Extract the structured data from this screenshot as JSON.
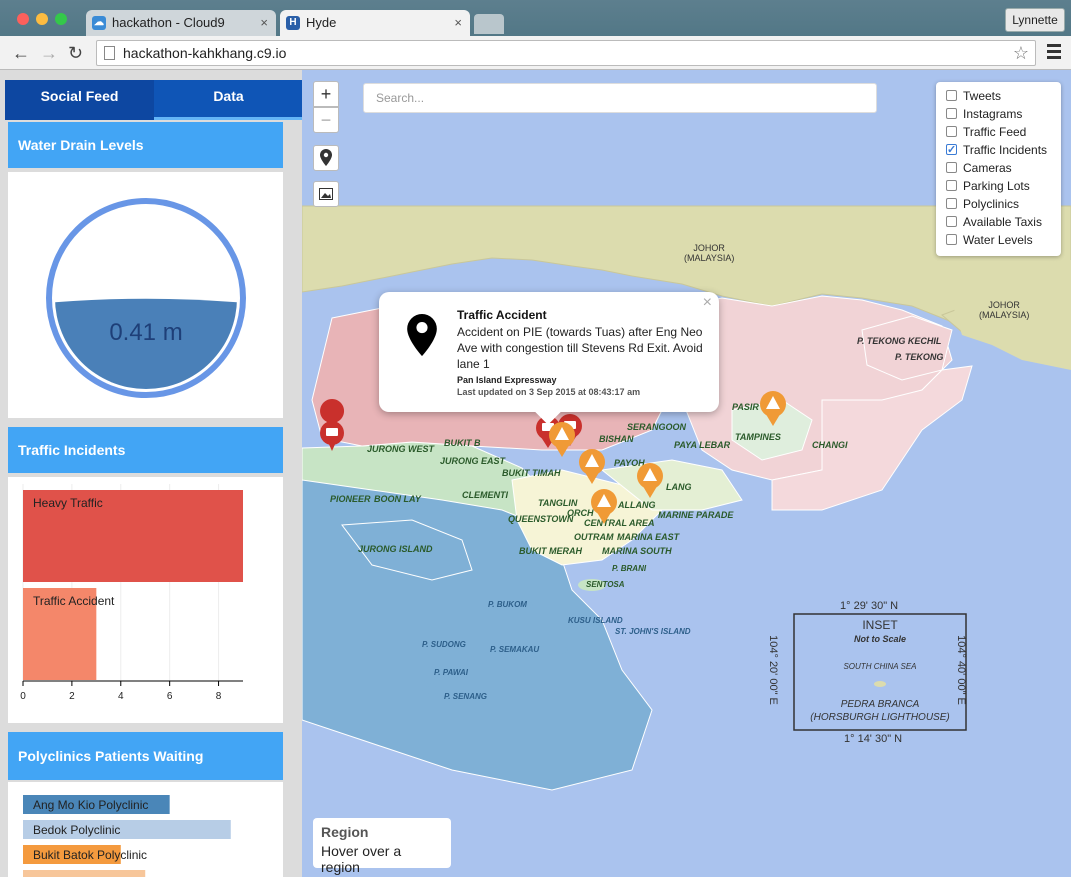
{
  "browser": {
    "tabs": [
      {
        "title": "hackathon - Cloud9",
        "close": "×"
      },
      {
        "title": "Hyde",
        "close": "×"
      }
    ],
    "url": "hackathon-kahkhang.c9.io",
    "user": "Lynnette",
    "back": "←",
    "forward": "→",
    "reload": "↻",
    "star": "☆"
  },
  "sidebar": {
    "tabs": [
      "Social Feed",
      "Data"
    ],
    "water": {
      "title": "Water Drain Levels",
      "value": "0.41 m",
      "level_fraction": 0.41
    },
    "traffic": {
      "title": "Traffic Incidents",
      "chart_data": {
        "type": "bar",
        "orientation": "horizontal",
        "categories": [
          "Heavy Traffic",
          "Traffic Accident"
        ],
        "values": [
          9,
          3
        ],
        "xlim": [
          0,
          9
        ],
        "xticks": [
          "0",
          "2",
          "4",
          "6",
          "8"
        ],
        "colors": [
          "#e0524a",
          "#f4876a"
        ]
      }
    },
    "polyclinics": {
      "title": "Polyclinics Patients Waiting",
      "chart_data": {
        "type": "bar",
        "orientation": "horizontal",
        "categories": [
          "Ang Mo Kio Polyclinic",
          "Bedok Polyclinic",
          "Bukit Batok Polyclinic",
          ""
        ],
        "values": [
          6,
          8.5,
          4,
          5
        ],
        "xlim": [
          0,
          9
        ],
        "colors": [
          "#4a86b8",
          "#b7cde6",
          "#f49a3e",
          "#f7c69a"
        ]
      }
    }
  },
  "map": {
    "zoom_in": "+",
    "zoom_out": "−",
    "search_placeholder": "Search...",
    "layers": [
      {
        "label": "Tweets",
        "checked": false
      },
      {
        "label": "Instagrams",
        "checked": false
      },
      {
        "label": "Traffic Feed",
        "checked": false
      },
      {
        "label": "Traffic Incidents",
        "checked": true
      },
      {
        "label": "Cameras",
        "checked": false
      },
      {
        "label": "Parking Lots",
        "checked": false
      },
      {
        "label": "Polyclinics",
        "checked": false
      },
      {
        "label": "Available Taxis",
        "checked": false
      },
      {
        "label": "Water Levels",
        "checked": false
      }
    ],
    "popup": {
      "title": "Traffic Accident",
      "body": "Accident on PIE (towards Tuas) after Eng Neo Ave with congestion till Stevens Rd Exit. Avoid lane 1",
      "road": "Pan Island Expressway",
      "updated": "Last updated on 3 Sep 2015 at 08:43:17 am",
      "close": "×"
    },
    "region": {
      "title": "Region",
      "hint": "Hover over a region"
    },
    "labels": {
      "johor1": "JOHOR\n(MALAYSIA)",
      "johor2": "JOHOR\n(MALAYSIA)",
      "tekong_kechil": "P. TEKONG KECHIL",
      "tekong": "P. TEKONG",
      "pasir": "PASIR R",
      "tampines": "TAMPINES",
      "changi": "CHANGI",
      "serangoon": "SERANGOON",
      "bishan": "BISHAN",
      "paya_lebar": "PAYA LEBAR",
      "payoh": "PAYOH",
      "bukit_timah": "BUKIT TIMAH",
      "jurong_west": "JURONG WEST",
      "jurong_east": "JURONG EAST",
      "bukit_b": "BUKIT B",
      "clementi": "CLEMENTI",
      "pioneer": "PIONEER",
      "boon_lay": "BOON LAY",
      "tanglin": "TANGLIN",
      "queenstown": "QUEENSTOWN",
      "orchard": "ORCH",
      "kallang": "ALLANG",
      "geylang": "LANG",
      "marine_parade": "MARINE PARADE",
      "central": "CENTRAL AREA",
      "outram": "OUTRAM",
      "marina_east": "MARINA EAST",
      "marina_south": "MARINA SOUTH",
      "bukit_merah": "BUKIT MERAH",
      "jurong_island": "JURONG ISLAND",
      "sentosa": "SENTOSA",
      "brani": "P. BRANI",
      "bukom": "P. BUKOM",
      "kusu": "KUSU ISLAND",
      "st_john": "ST. JOHN'S ISLAND",
      "sudong": "P. SUDONG",
      "semakau": "P. SEMAKAU",
      "pawai": "P. PAWAI",
      "senang": "P. SENANG"
    },
    "inset": {
      "title": "INSET",
      "subtitle": "Not to Scale",
      "sea": "SOUTH CHINA SEA",
      "island": "PEDRA BRANCA",
      "lighthouse": "(HORSBURGH LIGHTHOUSE)",
      "top": "1° 29' 30\" N",
      "bottom": "1° 14' 30\" N",
      "left": "104° 20' 00\" E",
      "right": "104° 40' 00\" E"
    }
  }
}
